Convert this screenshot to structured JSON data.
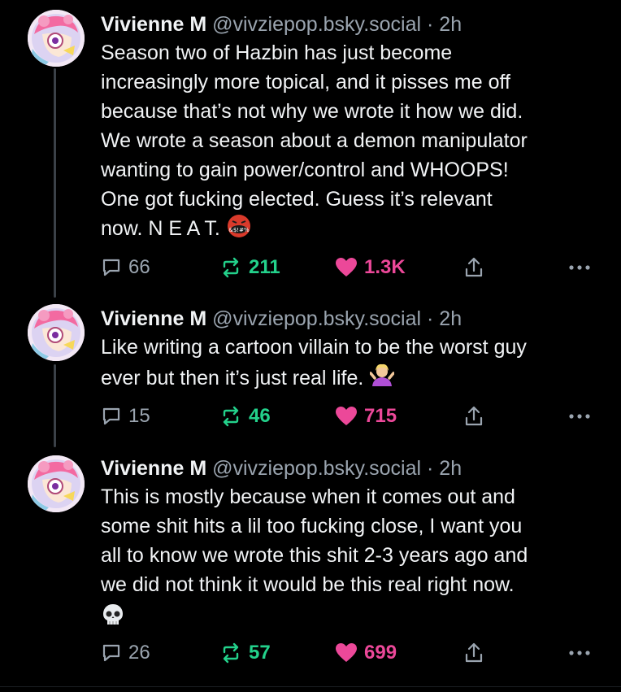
{
  "posts": [
    {
      "author": {
        "name": "Vivienne M",
        "handle": "@vivziepop.bsky.social"
      },
      "separator": "·",
      "time": "2h",
      "text": "Season two of Hazbin has just become\nincreasingly more topical, and it pisses me off\nbecause that’s not why we wrote it how we did.\nWe wrote a season about a demon manipulator\nwanting to gain power/control and WHOOPS!\nOne got fucking elected. Guess it’s relevant\nnow. N E A T.",
      "emoji": "face-with-symbols-on-mouth",
      "emoji_text": "&$!#%",
      "stats": {
        "replies": "66",
        "reposts": "211",
        "likes": "1.3K"
      }
    },
    {
      "author": {
        "name": "Vivienne M",
        "handle": "@vivziepop.bsky.social"
      },
      "separator": "·",
      "time": "2h",
      "text": "Like writing a cartoon villain to be the worst guy\never but then it’s just real life.",
      "emoji": "person-shrugging",
      "stats": {
        "replies": "15",
        "reposts": "46",
        "likes": "715"
      }
    },
    {
      "author": {
        "name": "Vivienne M",
        "handle": "@vivziepop.bsky.social"
      },
      "separator": "·",
      "time": "2h",
      "text": "This is mostly because when it comes out and\nsome shit hits a lil too fucking close, I want you\nall to know we wrote this shit 2-3 years ago and\nwe did not think it would be this real right now.",
      "emoji": "skull",
      "stats": {
        "replies": "26",
        "reposts": "57",
        "likes": "699"
      }
    }
  ],
  "icons": {
    "reply": "speech-bubble-icon",
    "repost": "repost-arrows-icon",
    "like": "heart-icon",
    "share": "share-icon",
    "more": "ellipsis-icon"
  },
  "colors": {
    "background": "#000000",
    "text": "#f1f3f5",
    "muted": "#9aa4af",
    "repost_active": "#23d18b",
    "like_active": "#ec4899",
    "thread_line": "#3b4148"
  }
}
